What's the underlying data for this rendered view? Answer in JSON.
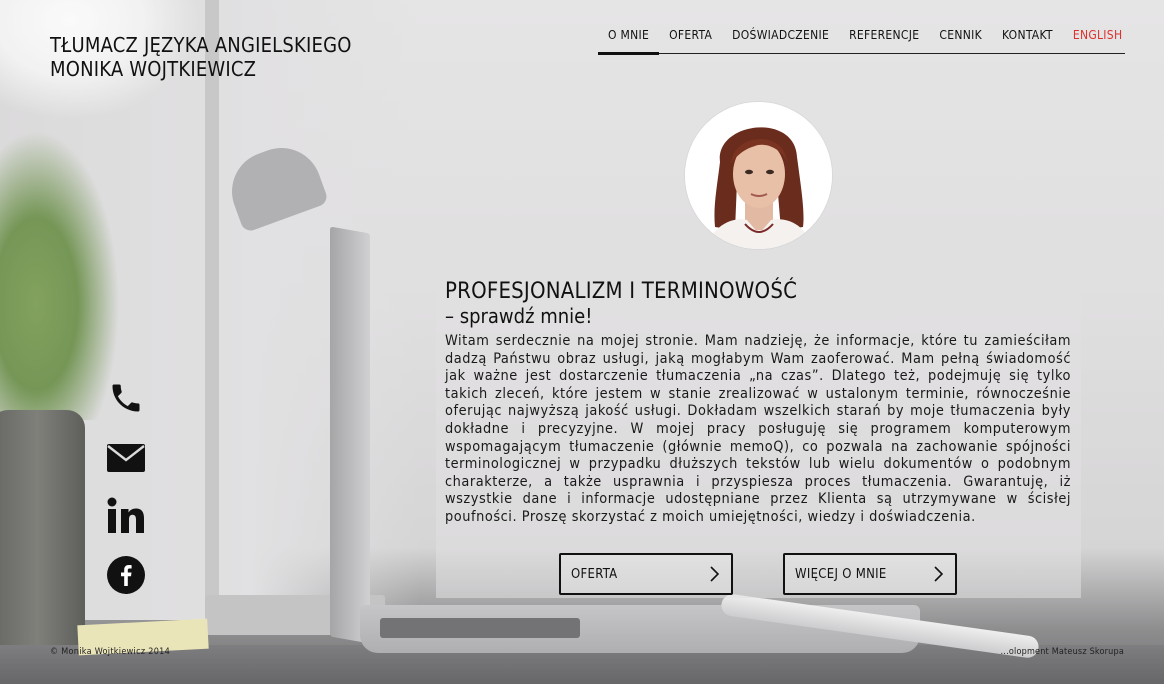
{
  "brand": {
    "line1": "TŁUMACZ JĘZYKA ANGIELSKIEGO",
    "line2": "MONIKA WOJTKIEWICZ"
  },
  "nav": {
    "items": [
      {
        "label": "O MNIE",
        "active": true
      },
      {
        "label": "OFERTA"
      },
      {
        "label": "DOŚWIADCZENIE"
      },
      {
        "label": "REFERENCJE"
      },
      {
        "label": "CENNIK"
      },
      {
        "label": "KONTAKT"
      },
      {
        "label": "ENGLISH",
        "color": "#e0302e"
      }
    ]
  },
  "main": {
    "title": "PROFESJONALIZM I TERMINOWOŚĆ",
    "subtitle": "– sprawdź mnie!",
    "body": "Witam serdecznie na mojej stronie. Mam nadzieję, że informacje, które tu zamieściłam dadzą Państwu obraz usługi, jaką mogłabym Wam zaoferować. Mam pełną świadomość jak ważne jest dostarczenie tłumaczenia „na czas”. Dlatego też, podejmuję się tylko takich zleceń, które jestem w stanie zrealizować w ustalonym terminie, równocześnie oferując najwyższą jakość usługi. Dokładam wszelkich starań by moje tłumaczenia były dokładne i precyzyjne. W mojej pracy posługuję się programem komputerowym wspomagającym tłumaczenie (głównie memoQ), co pozwala na zachowanie spójności terminologicznej w przypadku dłuższych tekstów lub wielu dokumentów o podobnym charakterze, a także usprawnia i przyspiesza proces tłumaczenia. Gwarantuję, iż wszystkie dane i informacje udostępniane przez Klienta są utrzymywane w ścisłej poufności. Proszę skorzystać z moich umiejętności, wiedzy i doświadczenia.",
    "buttons": {
      "oferta": "OFERTA",
      "more": "WIĘCEJ O MNIE"
    }
  },
  "social": {
    "icons": [
      "phone-icon",
      "mail-icon",
      "linkedin-icon",
      "facebook-icon"
    ]
  },
  "footer": {
    "copyright": "© Monika Wojtkiewicz 2014",
    "credit": "...olopment Mateusz Skorupa"
  },
  "colors": {
    "accent": "#e0302e",
    "text": "#111111"
  }
}
